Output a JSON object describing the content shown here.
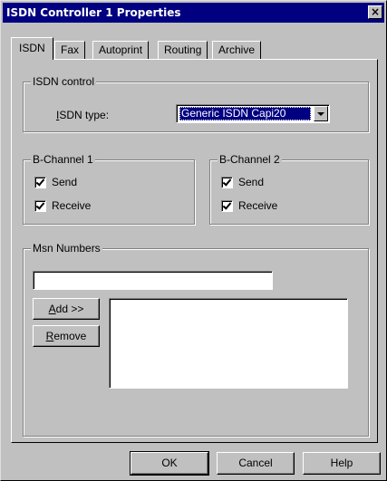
{
  "window": {
    "title": "ISDN Controller 1 Properties",
    "close_label": "×"
  },
  "tabs": [
    {
      "label": "ISDN",
      "active": true
    },
    {
      "label": "Fax"
    },
    {
      "label": "Autoprint"
    },
    {
      "label": "Routing"
    },
    {
      "label": "Archive"
    }
  ],
  "isdn_control": {
    "group_label": "ISDN control",
    "type_label_prefix": "",
    "type_label_accel": "I",
    "type_label_rest": "SDN type:",
    "type_value": "Generic ISDN Capi20"
  },
  "b_channel_1": {
    "group_label": "B-Channel 1",
    "send_label": "Send",
    "send_checked": true,
    "receive_label": "Receive",
    "receive_checked": true
  },
  "b_channel_2": {
    "group_label": "B-Channel 2",
    "send_label": "Send",
    "send_checked": true,
    "receive_label": "Receive",
    "receive_checked": true
  },
  "msn": {
    "group_label": "Msn Numbers",
    "input_value": "",
    "add_accel": "A",
    "add_rest": "dd >>",
    "remove_accel": "R",
    "remove_rest": "emove",
    "list_items": []
  },
  "buttons": {
    "ok": "OK",
    "cancel": "Cancel",
    "help": "Help"
  },
  "colors": {
    "titlebar": "#000080",
    "face": "#c0c0c0",
    "selection": "#000080"
  }
}
